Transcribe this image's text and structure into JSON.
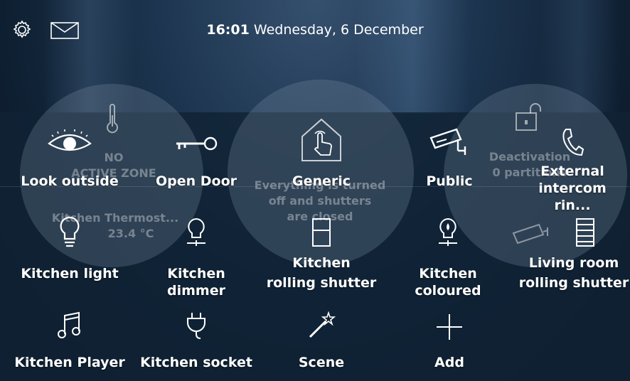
{
  "header": {
    "time": "16:01",
    "date": "Wednesday, 6 December",
    "settings_icon": "gear-icon",
    "messages_icon": "mail-icon"
  },
  "background_widgets": {
    "thermostat": {
      "status_line1": "NO",
      "status_line2": "ACTIVE ZONE",
      "name": "Kitchen Thermost...",
      "temperature": "23.4 °C"
    },
    "scenario": {
      "line1": "Everything is turned",
      "line2": "off and shutters",
      "line3": "are closed"
    },
    "alarm": {
      "line1": "Deactivation",
      "line2": "0 partitions"
    }
  },
  "tiles": [
    {
      "label": "Look outside",
      "icon": "eye-icon"
    },
    {
      "label": "Open Door",
      "icon": "key-icon"
    },
    {
      "label": "Generic",
      "icon": "home-touch-icon"
    },
    {
      "label": "Public",
      "icon": "camera-icon"
    },
    {
      "label": "External",
      "label2": "intercom rin...",
      "icon": "phone-icon"
    },
    {
      "label": "Kitchen light",
      "icon": "bulb-icon"
    },
    {
      "label": "Kitchen dimmer",
      "icon": "dimmer-bulb-icon"
    },
    {
      "label": "Kitchen",
      "label2": "rolling shutter",
      "icon": "shutter-icon"
    },
    {
      "label": "Kitchen coloured",
      "icon": "coloured-bulb-icon"
    },
    {
      "label": "Living room",
      "label2": "rolling shutter",
      "icon": "shutter-icon"
    },
    {
      "label": "Kitchen Player",
      "icon": "music-icon"
    },
    {
      "label": "Kitchen socket",
      "icon": "plug-icon"
    },
    {
      "label": "Scene",
      "icon": "magic-wand-icon"
    },
    {
      "label": "Add",
      "icon": "plus-icon"
    }
  ]
}
